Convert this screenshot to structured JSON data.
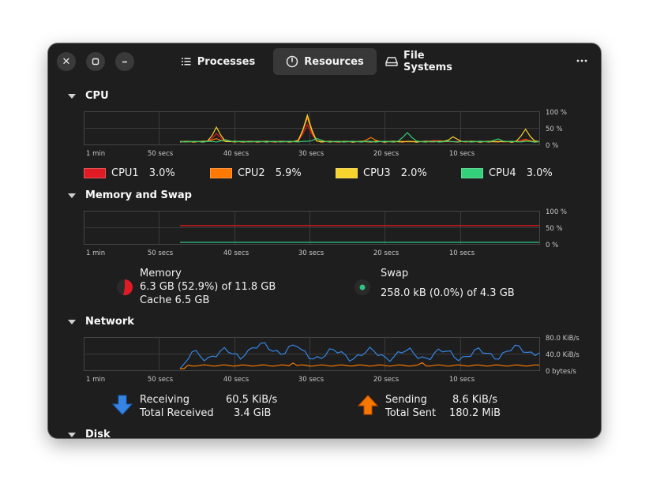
{
  "window": {
    "close_icon": "close-icon",
    "maximize_icon": "maximize-icon",
    "minimize_icon": "minimize-icon",
    "menu_icon": "more-horizontal-icon"
  },
  "tabs": [
    {
      "label": "Processes",
      "icon": "list-icon",
      "active": false
    },
    {
      "label": "Resources",
      "icon": "gauge-icon",
      "active": true
    },
    {
      "label": "File Systems",
      "icon": "drive-icon",
      "active": false
    }
  ],
  "time_ticks": [
    "1 min",
    "50 secs",
    "40 secs",
    "30 secs",
    "20 secs",
    "10 secs"
  ],
  "cpu": {
    "title": "CPU",
    "y_ticks": [
      "100 %",
      "50 %",
      "0 %"
    ],
    "cores": [
      {
        "name": "CPU1",
        "value": "3.0%",
        "color": "#e01b24"
      },
      {
        "name": "CPU2",
        "value": "5.9%",
        "color": "#ff7800"
      },
      {
        "name": "CPU3",
        "value": "2.0%",
        "color": "#f6d32d"
      },
      {
        "name": "CPU4",
        "value": "3.0%",
        "color": "#33d17a"
      }
    ]
  },
  "memory": {
    "title": "Memory and Swap",
    "y_ticks": [
      "100 %",
      "50 %",
      "0 %"
    ],
    "memory_label": "Memory",
    "memory_usage": "6.3 GB (52.9%) of 11.8 GB",
    "cache": "Cache 6.5 GB",
    "memory_color": "#e01b24",
    "memory_fraction": 0.529,
    "swap_label": "Swap",
    "swap_usage": "258.0 kB (0.0%) of 4.3 GB",
    "swap_color": "#2ec27e",
    "swap_fraction": 0.0
  },
  "network": {
    "title": "Network",
    "y_ticks": [
      "80.0 KiB/s",
      "40.0 KiB/s",
      "0 bytes/s"
    ],
    "receiving_label": "Receiving",
    "receiving_value": "60.5 KiB/s",
    "total_received_label": "Total Received",
    "total_received_value": "3.4 GiB",
    "sending_label": "Sending",
    "sending_value": "8.6 KiB/s",
    "total_sent_label": "Total Sent",
    "total_sent_value": "180.2 MiB",
    "receive_color": "#3584e4",
    "send_color": "#f57900"
  },
  "disk": {
    "title": "Disk"
  }
}
